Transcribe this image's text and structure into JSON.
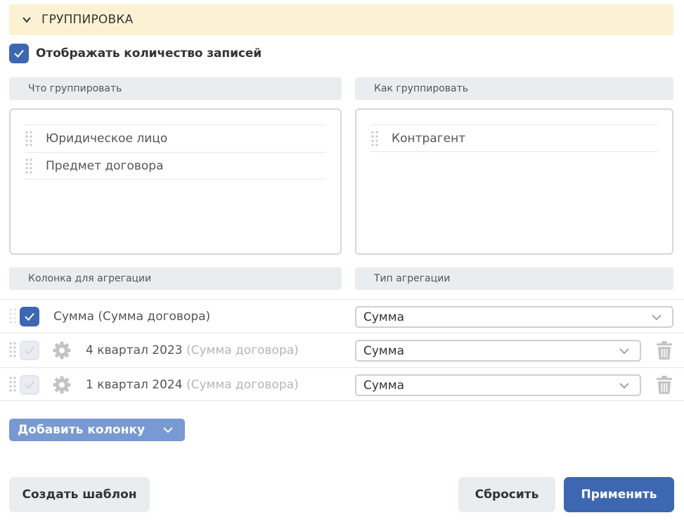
{
  "section": {
    "title": "ГРУППИРОВКА",
    "icon": "chevron-down-icon"
  },
  "show_count": {
    "label": "Отображать количество записей",
    "checked": true
  },
  "what_group": {
    "header": "Что группировать",
    "items": [
      {
        "label": "Юридическое лицо"
      },
      {
        "label": "Предмет договора"
      }
    ]
  },
  "how_group": {
    "header": "Как группировать",
    "items": [
      {
        "label": "Контрагент"
      }
    ]
  },
  "aggregation": {
    "column_header": "Колонка для агрегации",
    "type_header": "Тип агрегации",
    "rows": [
      {
        "name": "Сумма (Сумма договора)",
        "sub": "",
        "type": "Сумма",
        "checked": true,
        "disabled": false
      },
      {
        "name": "4 квартал 2023",
        "sub": "(Сумма договора)",
        "type": "Сумма",
        "checked": true,
        "disabled": true
      },
      {
        "name": "1 квартал 2024",
        "sub": "(Сумма договора)",
        "type": "Сумма",
        "checked": true,
        "disabled": true
      }
    ]
  },
  "add_column": {
    "label": "Добавить колонку"
  },
  "buttons": {
    "create_template": "Создать шаблон",
    "reset": "Сбросить",
    "apply": "Применить"
  },
  "colors": {
    "accent": "#3e67b1",
    "header_bg": "#fcf2d3",
    "add_button": "#7899d2",
    "muted_bg": "#e9edf0"
  }
}
